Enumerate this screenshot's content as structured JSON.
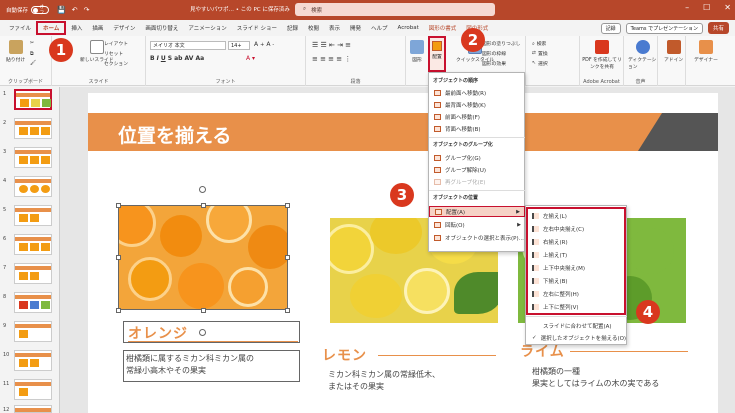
{
  "titlebar": {
    "autosave_label": "自動保存",
    "autosave_state": "オフ",
    "doc_title": "見やすいパワポ… • この PC に保存済み",
    "search_placeholder": "検索"
  },
  "tabs": [
    "ファイル",
    "ホーム",
    "挿入",
    "描画",
    "デザイン",
    "画面切り替え",
    "アニメーション",
    "スライド ショー",
    "記録",
    "校閲",
    "表示",
    "開発",
    "ヘルプ",
    "Acrobat",
    "図形の書式",
    "図の形式"
  ],
  "active_tab": "ホーム",
  "tab_right": {
    "record": "記録",
    "teams": "Teams でプレゼンテーション",
    "share": "共有"
  },
  "ribbon": {
    "clipboard": {
      "label": "クリップボード",
      "paste": "貼り付け"
    },
    "slides": {
      "label": "スライド",
      "new_slide": "新しいスライド",
      "layout": "レイアウト",
      "reset": "リセット",
      "section": "セクション"
    },
    "font": {
      "label": "フォント",
      "font_name": "メイリオ 本文",
      "font_size": "14+"
    },
    "paragraph": {
      "label": "段落"
    },
    "drawing": {
      "shape": "図形",
      "arrange": "配置",
      "quick_styles": "クイックスタイル",
      "fill": "図形の塗りつぶし",
      "outline": "図形の枠線",
      "effects": "図形の効果"
    },
    "editing": {
      "find": "検索",
      "replace": "置換",
      "select": "選択"
    },
    "adobe": {
      "create_pdf": "PDF を作成してリンクを共有",
      "label": "Adobe Acrobat"
    },
    "voice": {
      "dictate": "ディクテーション",
      "label": "音声"
    },
    "addins": {
      "label": "アドイン"
    },
    "designer": {
      "label": "デザイナー"
    }
  },
  "slide_numbers": [
    "1",
    "2",
    "3",
    "4",
    "5",
    "6",
    "7",
    "8",
    "9",
    "10",
    "11",
    "12"
  ],
  "slide": {
    "title": "位置を揃える",
    "items": [
      {
        "caption": "オレンジ",
        "desc1": "柑橘類に属するミカン科ミカン属の",
        "desc2": "常緑小高木やその果実"
      },
      {
        "caption": "レモン",
        "desc1": "ミカン科ミカン属の常緑低木、",
        "desc2": "またはその果実"
      },
      {
        "caption": "ライム",
        "desc1": "柑橘類の一種",
        "desc2": "果実としてはライムの木の実である"
      }
    ]
  },
  "menu": {
    "section_order": "オブジェクトの順序",
    "bring_front": "最前面へ移動(R)",
    "send_back": "最背面へ移動(K)",
    "bring_forward": "前面へ移動(F)",
    "send_backward": "背面へ移動(B)",
    "section_group": "オブジェクトのグループ化",
    "group": "グループ化(G)",
    "ungroup": "グループ解除(U)",
    "regroup": "再グループ化(E)",
    "section_position": "オブジェクトの位置",
    "align": "配置(A)",
    "rotate": "回転(O)",
    "selection_pane": "オブジェクトの選択と表示(P)..."
  },
  "submenu": {
    "align_left": "左揃え(L)",
    "align_center": "左右中央揃え(C)",
    "align_right": "右揃え(R)",
    "align_top": "上揃え(T)",
    "align_middle": "上下中央揃え(M)",
    "align_bottom": "下揃え(B)",
    "distribute_h": "左右に整列(H)",
    "distribute_v": "上下に整列(V)",
    "align_to_slide": "スライドに合わせて配置(A)",
    "align_selected": "選択したオブジェクトを揃える(O)"
  },
  "badges": [
    "1",
    "2",
    "3",
    "4"
  ],
  "colors": {
    "accent": "#b7472a",
    "highlight": "#c8102e",
    "slide_band": "#e8904a",
    "badge": "#d9381e"
  }
}
